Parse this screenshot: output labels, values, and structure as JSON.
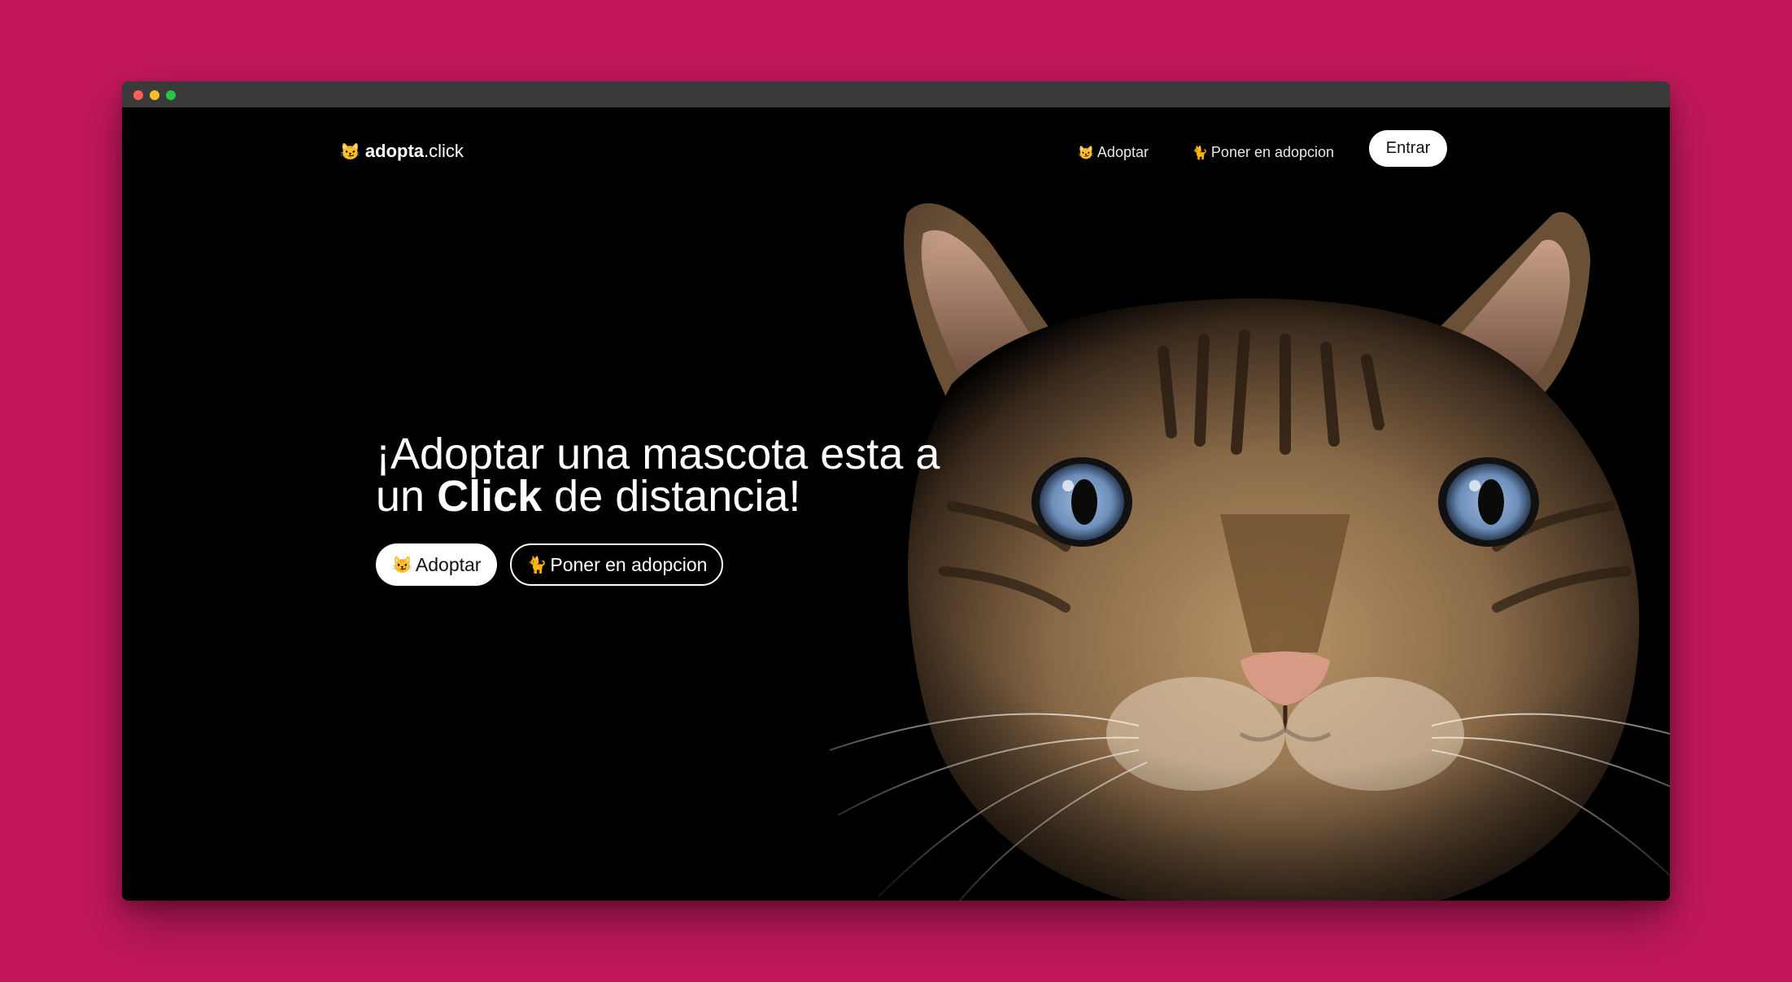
{
  "nav": {
    "logo_emoji": "😼",
    "logo_bold": "adopta",
    "logo_light": ".click",
    "links": [
      {
        "emoji": "😼",
        "label": "Adoptar"
      },
      {
        "emoji": "🐈",
        "label": "Poner en adopcion"
      }
    ],
    "login_label": "Entrar"
  },
  "hero": {
    "line1": "¡Adoptar una mascota esta a",
    "line2_pre": "un ",
    "line2_bold": "Click",
    "line2_post": " de distancia!",
    "primary_emoji": "😼",
    "primary_label": "Adoptar",
    "secondary_emoji": "🐈",
    "secondary_label": "Poner en adopcion"
  },
  "colors": {
    "background": "#C2185B",
    "page": "#000000",
    "titlebar": "#3a3a3a"
  }
}
